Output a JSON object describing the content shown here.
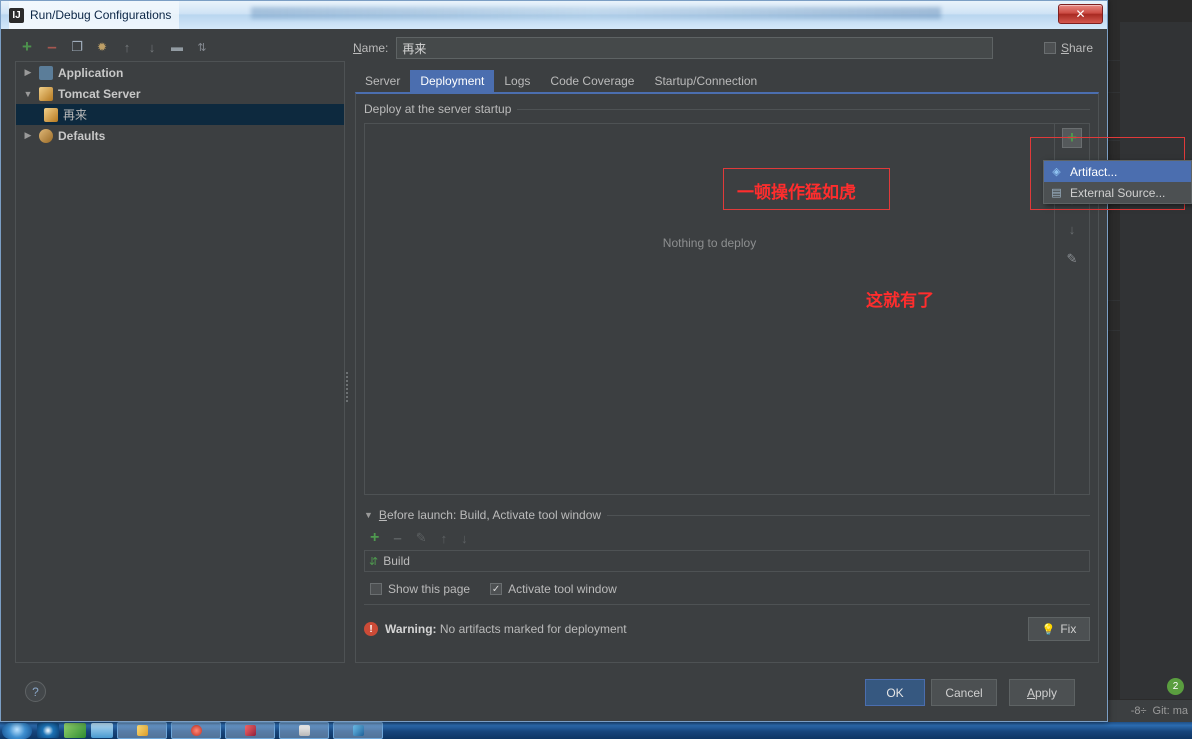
{
  "window": {
    "title": "Run/Debug Configurations",
    "title_icon": "intellij-idea-icon",
    "close_label": "✕"
  },
  "tree_toolbar": [
    {
      "name": "add-configuration-button",
      "glyph": "+",
      "color": "#4f9a4f"
    },
    {
      "name": "remove-configuration-button",
      "glyph": "–",
      "color": "#b05a52"
    },
    {
      "name": "copy-configuration-button",
      "glyph": "❐",
      "color": "#a9b7c6"
    },
    {
      "name": "edit-templates-button",
      "glyph": "🔧",
      "color": "#c9a86a"
    },
    {
      "name": "move-up-button",
      "glyph": "↑",
      "color": "#7a7e80"
    },
    {
      "name": "move-down-button",
      "glyph": "↓",
      "color": "#7a7e80"
    },
    {
      "name": "create-folder-button",
      "glyph": "▭",
      "color": "#9aa3ab"
    },
    {
      "name": "sort-configurations-button",
      "glyph": "⇅",
      "color": "#8b9097"
    }
  ],
  "tree": {
    "items": [
      {
        "label": "Application",
        "twisty": "▶",
        "icon": "application-icon",
        "icon_color": "#6897bb",
        "bold": true,
        "selected": false,
        "indent": 0
      },
      {
        "label": "Tomcat Server",
        "twisty": "▼",
        "icon": "tomcat-icon",
        "icon_color": "#d8a13a",
        "bold": true,
        "selected": false,
        "indent": 0
      },
      {
        "label": "再来",
        "twisty": "",
        "icon": "tomcat-icon",
        "icon_color": "#d8a13a",
        "bold": false,
        "selected": true,
        "indent": 1
      },
      {
        "label": "Defaults",
        "twisty": "▶",
        "icon": "defaults-icon",
        "icon_color": "#c99a5c",
        "bold": true,
        "selected": false,
        "indent": 0
      }
    ]
  },
  "form": {
    "name_label_prefix": "N",
    "name_label_rest": "ame:",
    "name_value": "再来",
    "name_placeholder": "",
    "share_label_prefix": "S",
    "share_label_rest": "hare",
    "share_checked": false,
    "share_mark": ""
  },
  "tabs": [
    {
      "label": "Server",
      "active": false
    },
    {
      "label": "Deployment",
      "active": true
    },
    {
      "label": "Logs",
      "active": false
    },
    {
      "label": "Code Coverage",
      "active": false
    },
    {
      "label": "Startup/Connection",
      "active": false
    }
  ],
  "deployment": {
    "section_title": "Deploy at the server startup",
    "empty_text": "Nothing to deploy",
    "vertical_toolbar": [
      {
        "name": "add-deployment-button",
        "glyph": "+",
        "color": "#4f9a4f"
      },
      {
        "name": "remove-deployment-button",
        "glyph": "–",
        "color": "#6d5b59"
      },
      {
        "name": "move-up-deployment-button",
        "glyph": "↑",
        "color": "#6a6e70"
      },
      {
        "name": "move-down-deployment-button",
        "glyph": "↓",
        "color": "#6a6e70"
      },
      {
        "name": "edit-deployment-button",
        "glyph": "✎",
        "color": "#8d9195"
      }
    ]
  },
  "popup_menu": {
    "items": [
      {
        "label": "Artifact...",
        "icon": "artifact-icon",
        "icon_color": "#6a9fd4",
        "selected": true
      },
      {
        "label": "External Source...",
        "icon": "external-source-icon",
        "icon_color": "#8fa8bd",
        "selected": false
      }
    ]
  },
  "before_launch": {
    "title": "Before launch: Build, Activate tool window",
    "title_prefix": "B",
    "title_rest": "efore launch: Build, Activate tool window",
    "twisty": "▼",
    "toolbar": [
      {
        "name": "add-before-launch-task-button",
        "glyph": "+",
        "color": "#4f9a4f"
      },
      {
        "name": "remove-before-launch-task-button",
        "glyph": "–",
        "color": "#5d6163"
      },
      {
        "name": "edit-before-launch-task-button",
        "glyph": "✎",
        "color": "#5d6163"
      },
      {
        "name": "move-up-before-launch-task-button",
        "glyph": "↑",
        "color": "#5d6163"
      },
      {
        "name": "move-down-before-launch-task-button",
        "glyph": "↓",
        "color": "#5d6163"
      }
    ],
    "task_label": "Build",
    "task_icon": "build-icon",
    "show_page_label": "Show this page",
    "show_page_checked": false,
    "show_page_mark": "",
    "activate_tool_window_label": "Activate tool window",
    "activate_tool_window_checked": true,
    "activate_tool_window_mark": "✓"
  },
  "warning": {
    "icon": "warning-icon",
    "icon_glyph": "!",
    "label": "Warning:",
    "message": "No artifacts marked for deployment",
    "fix_label": "Fix",
    "fix_icon": "lightbulb-icon",
    "fix_icon_glyph": "💡"
  },
  "footer": {
    "help_label": "?",
    "ok_label": "OK",
    "cancel_label": "Cancel",
    "apply_label_prefix": "A",
    "apply_label_rest": "pply"
  },
  "annotations": [
    {
      "name": "annotation-top-text",
      "text": "一顿操作猛如虎",
      "boxed": true
    },
    {
      "name": "annotation-bottom-text",
      "text": "这就有了",
      "boxed": false
    }
  ],
  "ide_background": {
    "status_git": "Git: ma",
    "status_encoding": "-8÷",
    "badge_count": "2"
  },
  "colors": {
    "accent_blue": "#4b6eaf",
    "selection_blue": "#0d293e",
    "panel_bg": "#3c3f41",
    "editor_bg": "#2b2b2b",
    "annotation_red": "#ff2d2d",
    "warning_red": "#cc4b37",
    "green_add": "#4f9a4f"
  }
}
